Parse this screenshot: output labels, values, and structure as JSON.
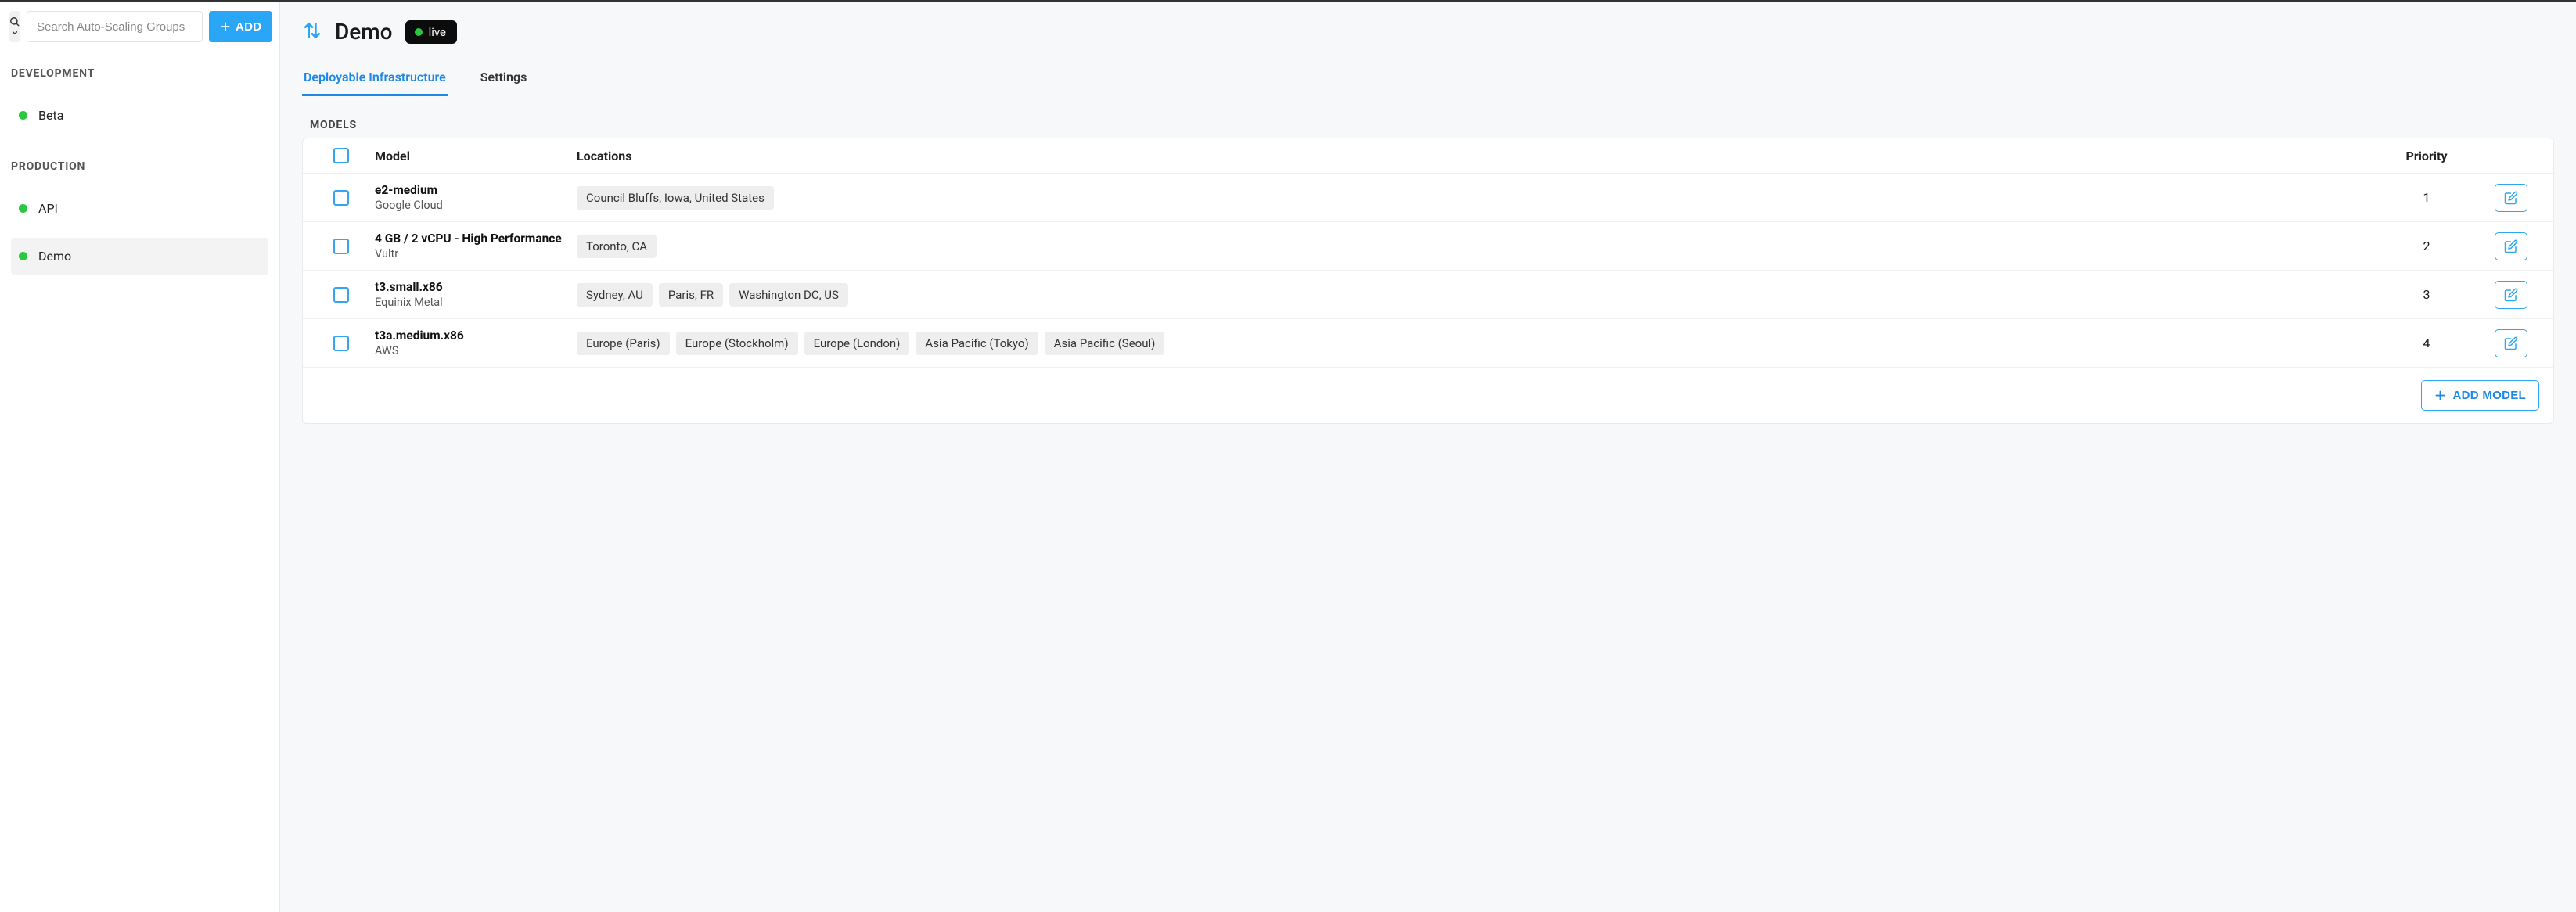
{
  "sidebar": {
    "search_placeholder": "Search Auto-Scaling Groups",
    "add_label": "ADD",
    "sections": [
      {
        "title": "DEVELOPMENT",
        "items": [
          {
            "label": "Beta",
            "status": "green",
            "active": false
          }
        ]
      },
      {
        "title": "PRODUCTION",
        "items": [
          {
            "label": "API",
            "status": "green",
            "active": false
          },
          {
            "label": "Demo",
            "status": "green",
            "active": true
          }
        ]
      }
    ]
  },
  "header": {
    "title": "Demo",
    "status_label": "live"
  },
  "tabs": [
    {
      "label": "Deployable Infrastructure",
      "active": true
    },
    {
      "label": "Settings",
      "active": false
    }
  ],
  "models": {
    "section_label": "MODELS",
    "columns": {
      "model": "Model",
      "locations": "Locations",
      "priority": "Priority"
    },
    "rows": [
      {
        "name": "e2-medium",
        "provider": "Google Cloud",
        "locations": [
          "Council Bluffs, Iowa, United States"
        ],
        "priority": 1
      },
      {
        "name": "4 GB / 2 vCPU - High Performance",
        "provider": "Vultr",
        "locations": [
          "Toronto, CA"
        ],
        "priority": 2
      },
      {
        "name": "t3.small.x86",
        "provider": "Equinix Metal",
        "locations": [
          "Sydney, AU",
          "Paris, FR",
          "Washington DC, US"
        ],
        "priority": 3
      },
      {
        "name": "t3a.medium.x86",
        "provider": "AWS",
        "locations": [
          "Europe (Paris)",
          "Europe (Stockholm)",
          "Europe (London)",
          "Asia Pacific (Tokyo)",
          "Asia Pacific (Seoul)"
        ],
        "priority": 4
      }
    ],
    "add_model_label": "ADD MODEL"
  }
}
